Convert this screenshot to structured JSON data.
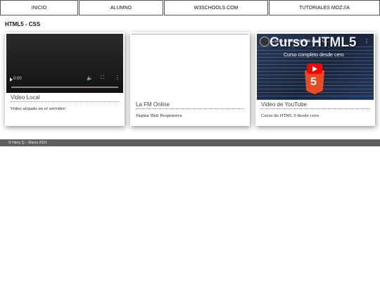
{
  "nav": {
    "items": [
      {
        "label": "INICIO"
      },
      {
        "label": "ALUMNO"
      },
      {
        "label": "W3SCHOOLS.COM"
      },
      {
        "label": "TUTORIALES MOZ://A"
      }
    ]
  },
  "page": {
    "title": "HTML5 - CSS"
  },
  "cards": [
    {
      "title": "Video Local",
      "description": "Video alojado en el servidor",
      "player": {
        "time": "0:00"
      }
    },
    {
      "title": "La FM Online",
      "description": "Página Web Responsive"
    },
    {
      "title": "Video de YouTube",
      "description": "Curso de HTML 5 desde cero",
      "youtube": {
        "video_title": "Curso HTML5 desde cero. C...",
        "thumb_heading": "Curso HTML5",
        "thumb_subheading": "Curso completo desde cero",
        "badge": "5"
      }
    }
  ],
  "footer": {
    "text": "© Harry Q. - Marzo 2021"
  },
  "colors": {
    "youtube_red": "#ff0000",
    "html5_orange": "#e44d26",
    "footer_bg": "#5f5f5f"
  }
}
